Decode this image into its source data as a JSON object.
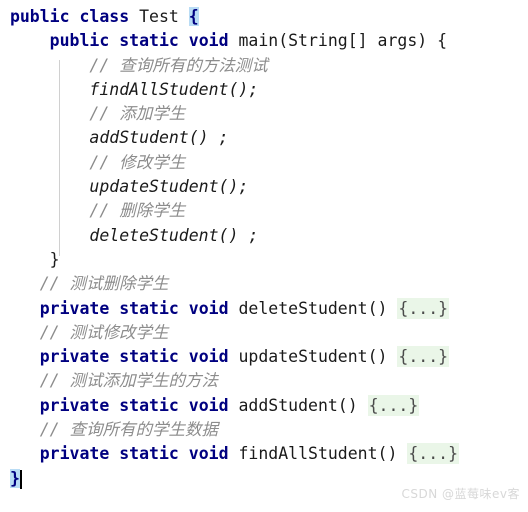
{
  "editor": {
    "language": "java",
    "class_name": "Test",
    "colors": {
      "keyword": "#000080",
      "comment": "#8c8c8c",
      "identifier": "#1a1a1a",
      "fold_background": "#eaf6e8",
      "brace_match_background": "#b9dcf5",
      "indent_guide": "#d0d0d0",
      "background": "#ffffff"
    }
  },
  "lines": {
    "l1": {
      "kw_public": "public",
      "kw_class": "class",
      "name": "Test",
      "brace": "{"
    },
    "l2": {
      "kw_public": "public",
      "kw_static": "static",
      "kw_void": "void",
      "signature": "main(String[] args) {"
    },
    "l3": {
      "comment": "// 查询所有的方法测试"
    },
    "l4": {
      "call": "findAllStudent();"
    },
    "l5": {
      "comment": "// 添加学生"
    },
    "l6": {
      "call": "addStudent() ;"
    },
    "l7": {
      "comment": "// 修改学生"
    },
    "l8": {
      "call": "updateStudent();"
    },
    "l9": {
      "comment": "// 删除学生"
    },
    "l10": {
      "call": "deleteStudent() ;"
    },
    "l11": {
      "brace": "}"
    },
    "l12": {
      "comment": "// 测试删除学生"
    },
    "l13": {
      "kw_private": "private",
      "kw_static": "static",
      "kw_void": "void",
      "method": "deleteStudent()",
      "fold": "{...}"
    },
    "l14": {
      "comment": "// 测试修改学生"
    },
    "l15": {
      "kw_private": "private",
      "kw_static": "static",
      "kw_void": "void",
      "method": "updateStudent()",
      "fold": "{...}"
    },
    "l16": {
      "comment": "// 测试添加学生的方法"
    },
    "l17": {
      "kw_private": "private",
      "kw_static": "static",
      "kw_void": "void",
      "method": "addStudent()",
      "fold": "{...}"
    },
    "l18": {
      "comment": "// 查询所有的学生数据"
    },
    "l19": {
      "kw_private": "private",
      "kw_static": "static",
      "kw_void": "void",
      "method": "findAllStudent()",
      "fold": "{...}"
    },
    "l20": {
      "brace": "}"
    }
  },
  "watermark": {
    "text": "CSDN @蓝莓味ev客"
  }
}
